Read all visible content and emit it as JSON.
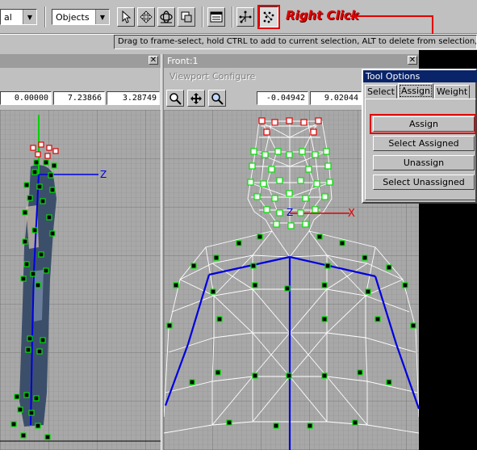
{
  "toolbar": {
    "dropdown1_value": "al",
    "dropdown2_value": "Objects",
    "status_text": "Drag to frame-select, hold CTRL to add to current selection, ALT to delete from selection, SHIFT"
  },
  "annotation": {
    "text": "Right Click"
  },
  "left_viewport": {
    "coords": [
      "0.00000",
      "7.23866",
      "3.28749"
    ],
    "axis_label": "Z"
  },
  "front_viewport": {
    "title": "Front:1",
    "menu": [
      "Viewport",
      "Configure"
    ],
    "coords": [
      "-0.04942",
      "9.02044"
    ],
    "axis_z": "Z",
    "axis_x": "X"
  },
  "tool_options": {
    "title": "Tool Options",
    "tabs": [
      "Select",
      "Assign",
      "Weight"
    ],
    "active_tab": "Assign",
    "buttons": [
      "Assign",
      "Select Assigned",
      "Unassign",
      "Select Unassigned"
    ]
  },
  "colors": {
    "highlight": "#e00000",
    "bone": "#0000e0",
    "vertex": "#00e000",
    "title_bar": "#0a246a"
  },
  "icons": [
    "select-arrow-icon",
    "move-icon",
    "rotate-icon",
    "region-icon",
    "window-icon",
    "bones-icon",
    "vertex-paint-icon",
    "zoom-icon",
    "pan-icon",
    "zoom-extents-icon"
  ]
}
